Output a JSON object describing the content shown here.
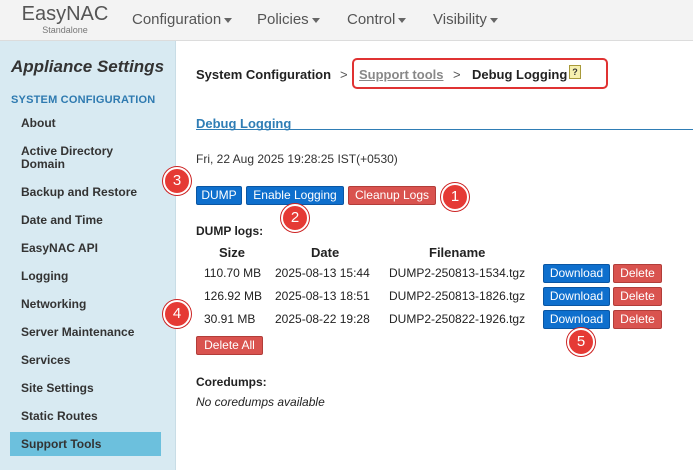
{
  "brand": {
    "name": "EasyNAC",
    "sub": "Standalone"
  },
  "nav": {
    "items": [
      "Configuration",
      "Policies",
      "Control",
      "Visibility"
    ]
  },
  "sidebar": {
    "title": "Appliance Settings",
    "section": "SYSTEM CONFIGURATION",
    "items": [
      "About",
      "Active Directory",
      "Domain",
      "Backup and Restore",
      "Date and Time",
      "EasyNAC API",
      "Logging",
      "Networking",
      "Server Maintenance",
      "Services",
      "Site Settings",
      "Static Routes",
      "Support Tools"
    ],
    "active": "Support Tools"
  },
  "breadcrumb": {
    "root": "System Configuration",
    "sep": ">",
    "link": "Support tools",
    "current": "Debug Logging",
    "help_icon": "help-note-icon"
  },
  "page": {
    "section_title": "Debug Logging",
    "datetime": "Fri, 22 Aug 2025 19:28:25 IST(+0530)",
    "buttons": {
      "dump": "DUMP",
      "enable": "Enable Logging",
      "cleanup": "Cleanup Logs",
      "delete_all": "Delete All"
    },
    "dump_label": "DUMP logs:",
    "columns": [
      "Size",
      "Date",
      "Filename"
    ],
    "rows": [
      {
        "size": "110.70 MB",
        "date": "2025-08-13 15:44",
        "filename": "DUMP2-250813-1534.tgz",
        "download": "Download",
        "delete": "Delete"
      },
      {
        "size": "126.92 MB",
        "date": "2025-08-13 18:51",
        "filename": "DUMP2-250813-1826.tgz",
        "download": "Download",
        "delete": "Delete"
      },
      {
        "size": "30.91 MB",
        "date": "2025-08-22 19:28",
        "filename": "DUMP2-250822-1926.tgz",
        "download": "Download",
        "delete": "Delete"
      }
    ],
    "coredumps_label": "Coredumps:",
    "coredumps_empty": "No coredumps available"
  },
  "annotations": [
    "1",
    "2",
    "3",
    "4",
    "5"
  ],
  "colors": {
    "accent_blue": "#0e6fcd",
    "danger_red": "#d9534f",
    "sidebar_bg": "#d8eaf2",
    "sidebar_active": "#6cc0dd",
    "annotation_red": "#e53a35"
  }
}
